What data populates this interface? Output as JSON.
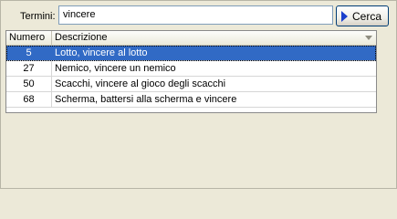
{
  "search": {
    "label": "Termini:",
    "value": "vincere",
    "button_label": "Cerca",
    "button_icon": "play-arrow-icon",
    "icon_color": "#1a3fcc"
  },
  "table": {
    "columns": [
      "Numero",
      "Descrizione"
    ],
    "rows": [
      {
        "numero": "5",
        "descrizione": "Lotto, vincere al lotto",
        "selected": true
      },
      {
        "numero": "27",
        "descrizione": "Nemico, vincere un nemico",
        "selected": false
      },
      {
        "numero": "50",
        "descrizione": "Scacchi, vincere al gioco degli scacchi",
        "selected": false
      },
      {
        "numero": "68",
        "descrizione": "Scherma, battersi alla scherma e vincere",
        "selected": false
      }
    ],
    "selection_color": "#316ac5"
  }
}
